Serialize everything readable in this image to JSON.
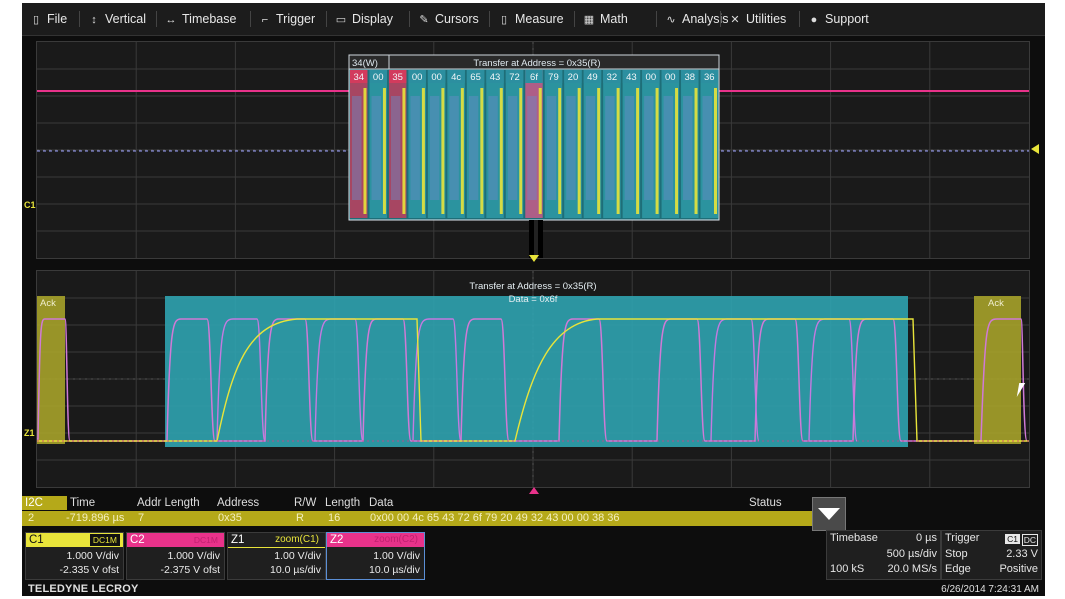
{
  "menu": [
    {
      "icon": "file-icon",
      "glyph": "▯",
      "label": "File"
    },
    {
      "icon": "vertical-icon",
      "glyph": "↕",
      "label": "Vertical"
    },
    {
      "icon": "timebase-icon",
      "glyph": "↔",
      "label": "Timebase"
    },
    {
      "icon": "trigger-icon",
      "glyph": "⌐",
      "label": "Trigger"
    },
    {
      "icon": "display-icon",
      "glyph": "▭",
      "label": "Display"
    },
    {
      "icon": "cursors-icon",
      "glyph": "✎",
      "label": "Cursors"
    },
    {
      "icon": "measure-icon",
      "glyph": "▯",
      "label": "Measure"
    },
    {
      "icon": "math-icon",
      "glyph": "▦",
      "label": "Math"
    },
    {
      "icon": "analysis-icon",
      "glyph": "∿",
      "label": "Analysis"
    },
    {
      "icon": "utilities-icon",
      "glyph": "✕",
      "label": "Utilities"
    },
    {
      "icon": "support-icon",
      "glyph": "●",
      "label": "Support"
    }
  ],
  "top_grid": {
    "decode_first_label": "34(W)",
    "decode_title": "Transfer at Address = 0x35(R)",
    "bytes": [
      "34",
      "00",
      "35",
      "00",
      "00",
      "4c",
      "65",
      "43",
      "72",
      "6f",
      "79",
      "20",
      "49",
      "32",
      "43",
      "00",
      "00",
      "38",
      "36"
    ],
    "channel_label": "C1"
  },
  "zoom_grid": {
    "title_line1": "Transfer at Address = 0x35(R)",
    "title_line2": "Data = 0x6f",
    "ack_left": "Ack",
    "ack_right": "Ack",
    "channel_label": "Z1"
  },
  "decode_table": {
    "headers": [
      "I2C",
      "Time",
      "Addr Length",
      "Address",
      "R/W",
      "Length",
      "Data",
      "Status"
    ],
    "row": {
      "index": "2",
      "time": "-719.896 µs",
      "addr_length": "7",
      "address": "0x35",
      "rw": "R",
      "length": "16",
      "data": "0x00 00 4c 65 43 72 6f 79 20 49 32 43 00 00 38 36",
      "status": ""
    }
  },
  "channels": [
    {
      "name": "C1",
      "tag": "DC1M",
      "line1": "1.000 V/div",
      "line2": "-2.335 V ofst",
      "color": "#e8e43a"
    },
    {
      "name": "C2",
      "tag": "DC1M",
      "line1": "1.000 V/div",
      "line2": "-2.375 V ofst",
      "color": "#e8328a"
    },
    {
      "name": "Z1",
      "tag": "zoom(C1)",
      "line1": "1.00 V/div",
      "line2": "10.0 µs/div",
      "color": "#e8e43a"
    },
    {
      "name": "Z2",
      "tag": "zoom(C2)",
      "line1": "1.00 V/div",
      "line2": "10.0 µs/div",
      "color": "#e8328a"
    }
  ],
  "timebase": {
    "label": "Timebase",
    "delay": "0 µs",
    "per_div": "500 µs/div",
    "samples": "100 kS",
    "rate": "20.0 MS/s"
  },
  "trigger": {
    "label": "Trigger",
    "source": "C1",
    "coupling": "DC",
    "mode": "Stop",
    "level": "2.33 V",
    "type": "Edge",
    "slope": "Positive"
  },
  "footer": {
    "brand": "TELEDYNE LECROY",
    "datetime": "6/26/2014 7:24:31 AM"
  },
  "colors": {
    "c1": "#e8e43a",
    "c2": "#e8328a",
    "decode_bg": "#2e9aa6",
    "addr_bg": "#c0405e",
    "zoom_bg": "#2fa3b0",
    "ack_bg": "#a6a22a",
    "table_row": "#b5a919"
  }
}
